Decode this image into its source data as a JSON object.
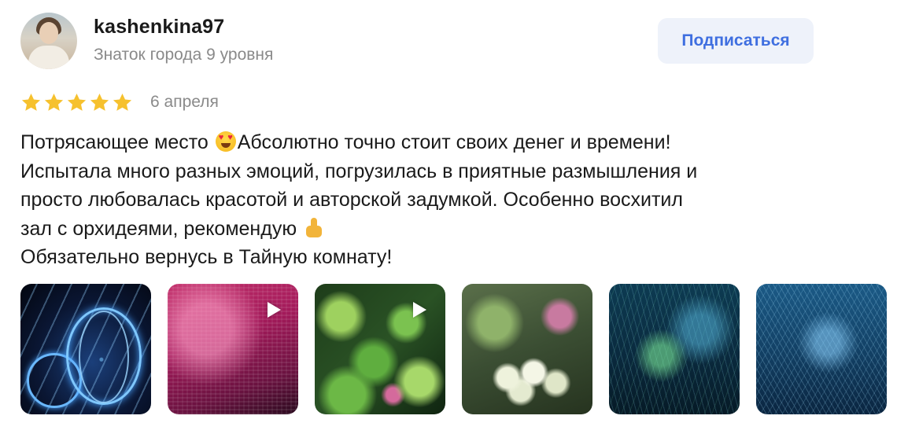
{
  "user": {
    "name": "kashenkina97",
    "level": "Знаток города 9 уровня"
  },
  "subscribe_label": "Подписаться",
  "review": {
    "rating": 5,
    "rating_max": 5,
    "date": "6 апреля",
    "text_lines": [
      {
        "before": "Потрясающее место ",
        "emoji": "smiling-face-with-heart-eyes",
        "after": "Абсолютно точно стоит своих денег и времени!"
      },
      {
        "before": "Испытала много разных эмоций, погрузилась в приятные размышления и"
      },
      {
        "before": "просто любовалась красотой и авторской задумкой. Особенно восхитил"
      },
      {
        "before": "зал с орхидеями, рекомендую ",
        "emoji": "thumbs-up"
      },
      {
        "before": "Обязательно вернусь в Тайную комнату!"
      }
    ]
  },
  "photos": [
    {
      "kind": "photo",
      "icon": null
    },
    {
      "kind": "video",
      "icon": "play-icon"
    },
    {
      "kind": "video",
      "icon": "play-icon"
    },
    {
      "kind": "photo",
      "icon": null
    },
    {
      "kind": "photo",
      "icon": null
    },
    {
      "kind": "photo",
      "icon": null
    }
  ],
  "colors": {
    "star": "#f6c12e",
    "subscribe_bg": "#eef2fa",
    "subscribe_text": "#3f6fe0",
    "muted_text": "#8a8a8a"
  }
}
